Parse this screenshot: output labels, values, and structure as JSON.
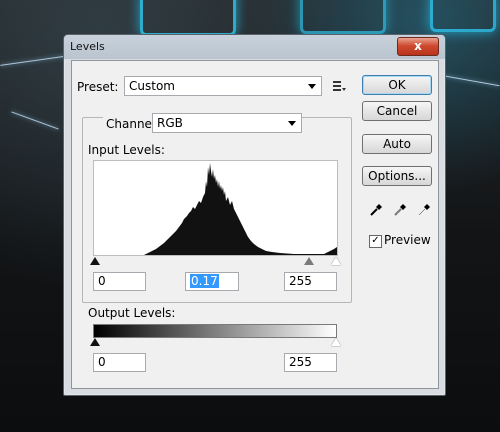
{
  "window": {
    "title": "Levels",
    "close_label": "x"
  },
  "preset": {
    "label": "Preset:",
    "value": "Custom"
  },
  "channel": {
    "label": "Channel:",
    "value": "RGB"
  },
  "input_levels": {
    "label": "Input Levels:",
    "shadow": "0",
    "midtone": "0.17",
    "highlight": "255"
  },
  "output_levels": {
    "label": "Output Levels:",
    "shadow": "0",
    "highlight": "255"
  },
  "buttons": {
    "ok": "OK",
    "cancel": "Cancel",
    "auto": "Auto",
    "options": "Options..."
  },
  "preview": {
    "label": "Preview",
    "checked": true
  },
  "colors": {
    "accent": "#3399ff",
    "window_bg": "#f0f0f0",
    "close": "#c8432a"
  },
  "icons": [
    "preset-menu-icon",
    "black-eyedropper-icon",
    "gray-eyedropper-icon",
    "white-eyedropper-icon"
  ]
}
